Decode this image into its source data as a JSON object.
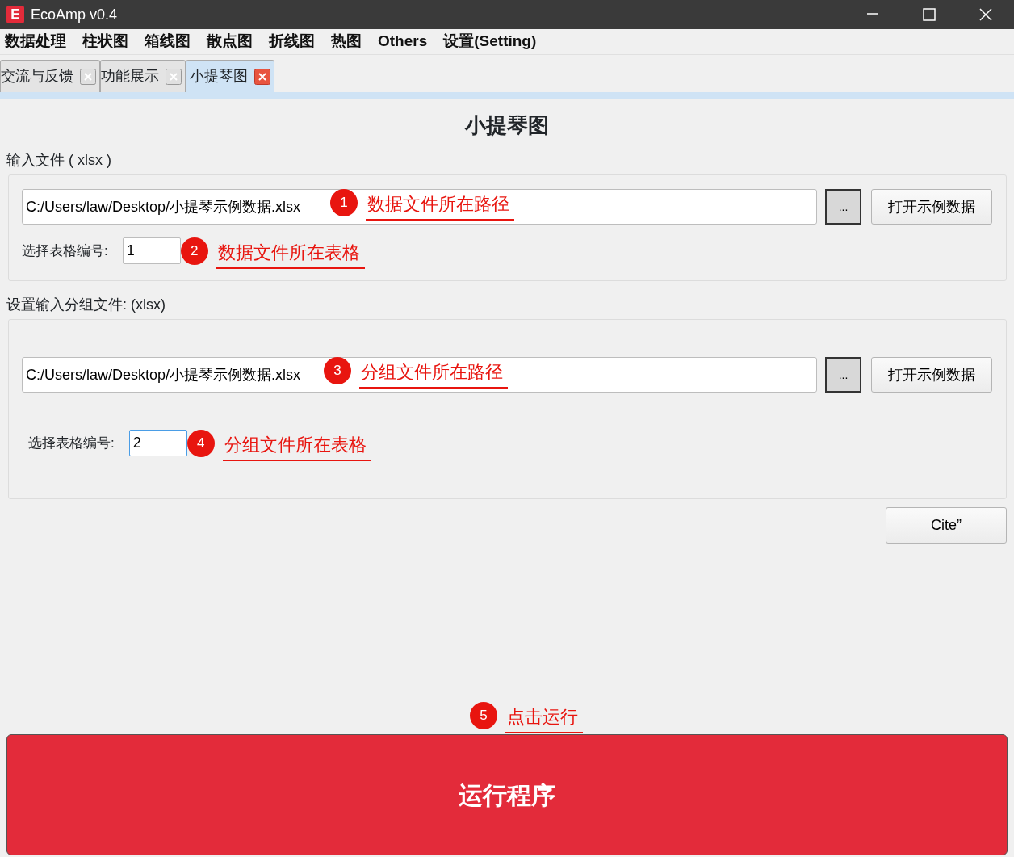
{
  "window": {
    "logo": "E",
    "title": "EcoAmp v0.4"
  },
  "menu": [
    "数据处理",
    "柱状图",
    "箱线图",
    "散点图",
    "折线图",
    "热图",
    "Others",
    "设置(Setting)"
  ],
  "tabs": [
    {
      "label": "交流与反馈",
      "selected": false
    },
    {
      "label": "功能展示",
      "selected": false
    },
    {
      "label": "小提琴图",
      "selected": true
    }
  ],
  "page_title": "小提琴图",
  "sections": [
    {
      "label": "输入文件 ( xlsx )",
      "path": "C:/Users/law/Desktop/小提琴示例数据.xlsx",
      "browse": "...",
      "example": "打开示例数据",
      "sheet_label": "选择表格编号:",
      "sheet_value": "1",
      "focused": false
    },
    {
      "label": "设置输入分组文件: (xlsx)",
      "path": "C:/Users/law/Desktop/小提琴示例数据.xlsx",
      "browse": "...",
      "example": "打开示例数据",
      "sheet_label": "选择表格编号:",
      "sheet_value": "2",
      "focused": true
    }
  ],
  "cite": "Cite”",
  "run": "运行程序",
  "annotations": [
    {
      "number": "1",
      "text": "数据文件所在路径"
    },
    {
      "number": "2",
      "text": "数据文件所在表格"
    },
    {
      "number": "3",
      "text": "分组文件所在路径"
    },
    {
      "number": "4",
      "text": "分组文件所在表格"
    },
    {
      "number": "5",
      "text": "点击运行"
    }
  ]
}
